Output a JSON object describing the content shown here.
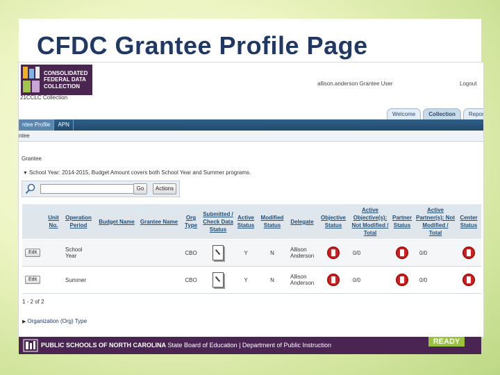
{
  "slide": {
    "title": "CFDC Grantee Profile Page"
  },
  "header": {
    "logo_lines": [
      "CONSOLIDATED",
      "FEDERAL DATA",
      "COLLECTION"
    ],
    "app_name": "21CCLC Collection",
    "user": "allison.anderson Grantee User",
    "logout": "Logout"
  },
  "tabs": [
    {
      "label": "Welcome",
      "active": false
    },
    {
      "label": "Collection",
      "active": true
    },
    {
      "label": "Reports",
      "active": false
    }
  ],
  "nav": {
    "items": [
      "ntee Profile",
      "APN"
    ],
    "crumb": "ntee"
  },
  "page": {
    "heading": "Grantee",
    "program_text": "School Year: 2014-2015, Budget Amount covers both School Year and Summer programs."
  },
  "search": {
    "value": "",
    "go_label": "Go",
    "actions_label": "Actions"
  },
  "table": {
    "columns": [
      "Unit No.",
      "Operation Period",
      "Budget Name",
      "Grantee Name",
      "Org Type",
      "Submitted / Check Data Status",
      "Active Status",
      "Modified Status",
      "Delegate",
      "Objective Status",
      "Active Objective(s): Not Modified / Total",
      "Partner Status",
      "Active Partner(s): Not Modified / Total",
      "Center Status"
    ],
    "edit_label": "Edit",
    "rows": [
      {
        "operation_period": "School Year",
        "budget_name": "",
        "grantee_name": "",
        "org_type": "CBO",
        "active": "Y",
        "modified": "N",
        "delegate": "Allison Anderson",
        "objectives": "0/0",
        "partners": "0/0"
      },
      {
        "operation_period": "Summer",
        "budget_name": "",
        "grantee_name": "",
        "org_type": "CBO",
        "active": "Y",
        "modified": "N",
        "delegate": "Allison Anderson",
        "objectives": "0/0",
        "partners": "0/0"
      }
    ],
    "count_text": "1 - 2 of 2"
  },
  "org_section": "Organization (Org) Type",
  "footer": {
    "bold_text": "PUBLIC SCHOOLS OF NORTH CAROLINA",
    "rest_text": "State Board of Education | Department of Public Instruction",
    "badge": "READY"
  },
  "colors": {
    "title": "#1f3864",
    "purple": "#4a2552",
    "status_red": "#d62020",
    "arrow_red": "#e0201b",
    "nav_blue": "#2f5f86"
  },
  "icons": [
    "search-icon",
    "document-icon",
    "status-stop-icon",
    "arrow-icon"
  ]
}
